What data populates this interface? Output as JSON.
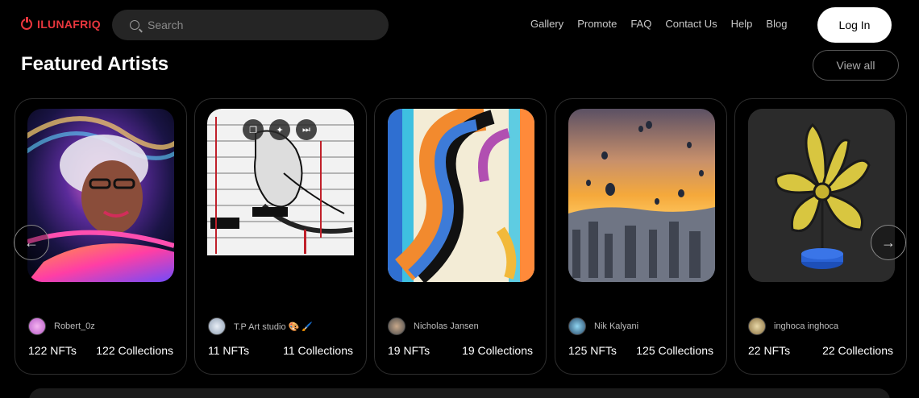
{
  "header": {
    "logo_text": "ILUNAFRIQ",
    "search_placeholder": "Search",
    "nav": [
      "Gallery",
      "Promote",
      "FAQ",
      "Contact Us",
      "Help",
      "Blog"
    ],
    "login_label": "Log In"
  },
  "section": {
    "title": "Featured Artists",
    "view_all_label": "View all"
  },
  "artists": [
    {
      "name": "Robert_0z",
      "nfts": "122 NFTs",
      "collections": "122 Collections",
      "art": "portrait-woman-colorful"
    },
    {
      "name": "T.P Art studio 🎨 🖌️",
      "nfts": "11 NFTs",
      "collections": "11 Collections",
      "art": "politics-sketch"
    },
    {
      "name": "Nicholas Jansen",
      "nfts": "19 NFTs",
      "collections": "19 Collections",
      "art": "abstract-s-stripes"
    },
    {
      "name": "Nik Kalyani",
      "nfts": "125 NFTs",
      "collections": "125 Collections",
      "art": "hot-air-balloons-sunset"
    },
    {
      "name": "inghoca inghoca",
      "nfts": "22 NFTs",
      "collections": "22 Collections",
      "art": "yellow-3d-flower"
    }
  ],
  "colors": {
    "brand": "#e8363d",
    "background": "#000000"
  }
}
